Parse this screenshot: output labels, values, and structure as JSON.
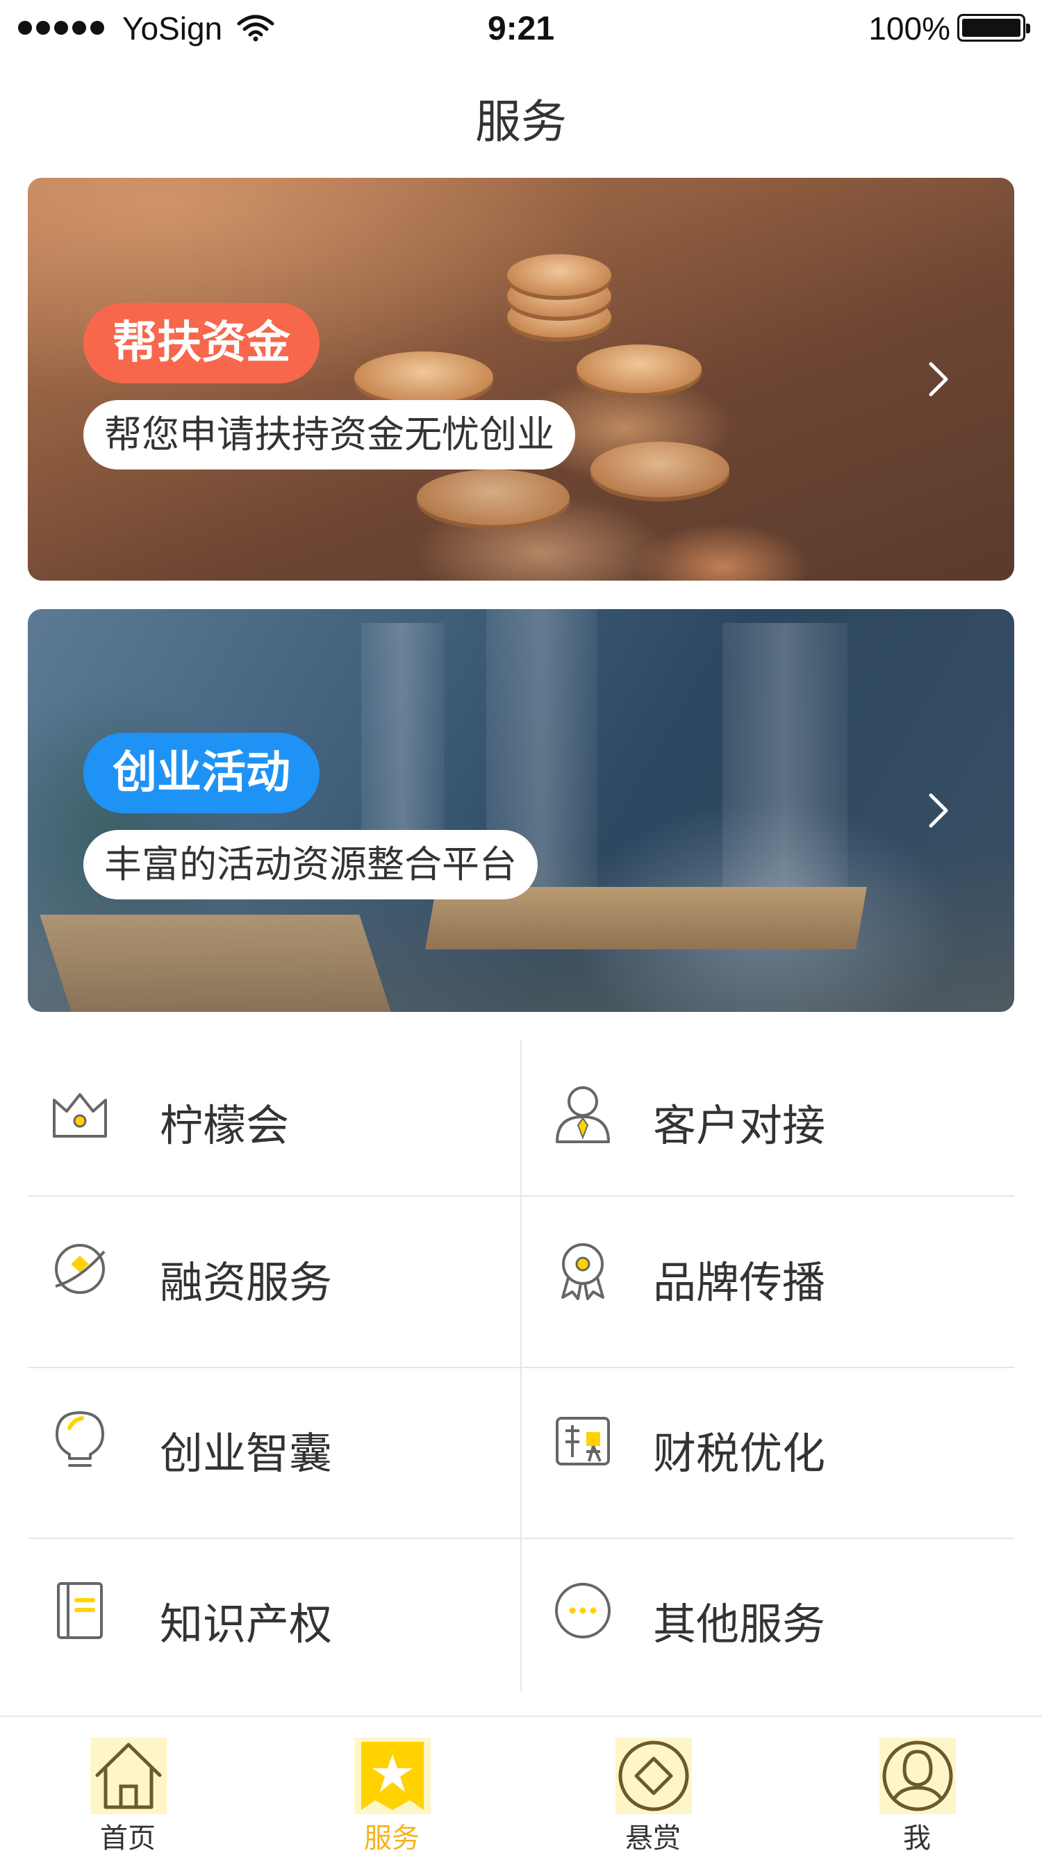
{
  "status_bar": {
    "carrier": "YoSign",
    "time": "9:21",
    "battery": "100%"
  },
  "nav": {
    "title": "服务"
  },
  "banners": [
    {
      "tag": "帮扶资金",
      "subtitle": "帮您申请扶持资金无忧创业",
      "tag_color": "#f7674c"
    },
    {
      "tag": "创业活动",
      "subtitle": "丰富的活动资源整合平台",
      "tag_color": "#1f93f5"
    }
  ],
  "services": [
    {
      "label": "柠檬会",
      "icon": "crown-icon"
    },
    {
      "label": "客户对接",
      "icon": "person-tie-icon"
    },
    {
      "label": "融资服务",
      "icon": "planet-icon"
    },
    {
      "label": "品牌传播",
      "icon": "badge-icon"
    },
    {
      "label": "创业智囊",
      "icon": "lightbulb-icon"
    },
    {
      "label": "财税优化",
      "icon": "tax-icon"
    },
    {
      "label": "知识产权",
      "icon": "notebook-icon"
    },
    {
      "label": "其他服务",
      "icon": "more-icon"
    }
  ],
  "tabbar": {
    "items": [
      {
        "label": "首页",
        "icon": "home-icon"
      },
      {
        "label": "服务",
        "icon": "service-star-icon"
      },
      {
        "label": "悬赏",
        "icon": "reward-diamond-icon"
      },
      {
        "label": "我",
        "icon": "profile-icon"
      }
    ],
    "active_index": 1,
    "accent": "#f7b31a"
  }
}
